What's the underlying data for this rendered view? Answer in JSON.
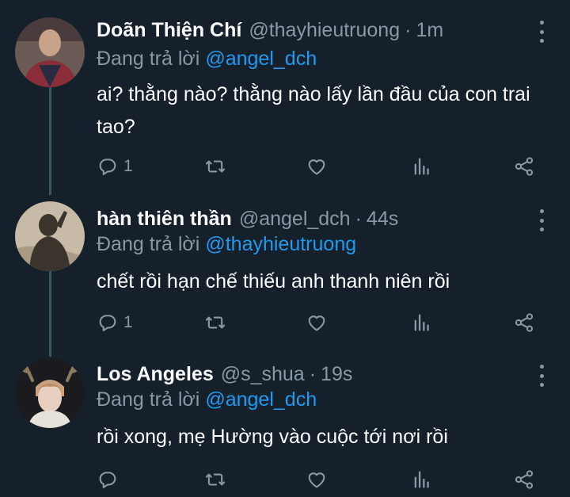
{
  "tweets": [
    {
      "display_name": "Doãn Thiện Chí",
      "handle": "@thayhieutruong",
      "separator": "·",
      "time": "1m",
      "replying_prefix": "Đang trả lời",
      "replying_to": "@angel_dch",
      "text": "ai? thằng nào? thằng nào lấy lần đầu của con trai tao?",
      "reply_count": "1",
      "avatar": "man-in-red-plaid-shirt-photo"
    },
    {
      "display_name": "hàn thiên thần",
      "handle": "@angel_dch",
      "separator": "·",
      "time": "44s",
      "replying_prefix": "Đang trả lời",
      "replying_to": "@thayhieutruong",
      "text": "chết rồi hạn chế thiếu anh thanh niên rồi",
      "reply_count": "1",
      "avatar": "shadow-silhouette-photo"
    },
    {
      "display_name": "Los Angeles",
      "handle": "@s_shua",
      "separator": "·",
      "time": "19s",
      "replying_prefix": "Đang trả lời",
      "replying_to": "@angel_dch",
      "text": "rồi xong, mẹ Hường vào cuộc tới nơi rồi",
      "reply_count": "",
      "avatar": "person-with-deer-antlers-photo"
    }
  ],
  "icons": {
    "reply": "reply-icon",
    "retweet": "retweet-icon",
    "like": "like-icon",
    "analytics": "analytics-icon",
    "share": "share-icon",
    "more": "more-icon"
  },
  "colors": {
    "background": "#15202b",
    "text": "#ffffff",
    "muted": "#8899a6",
    "link": "#1d9bf0",
    "thread_line": "#3d5466"
  }
}
